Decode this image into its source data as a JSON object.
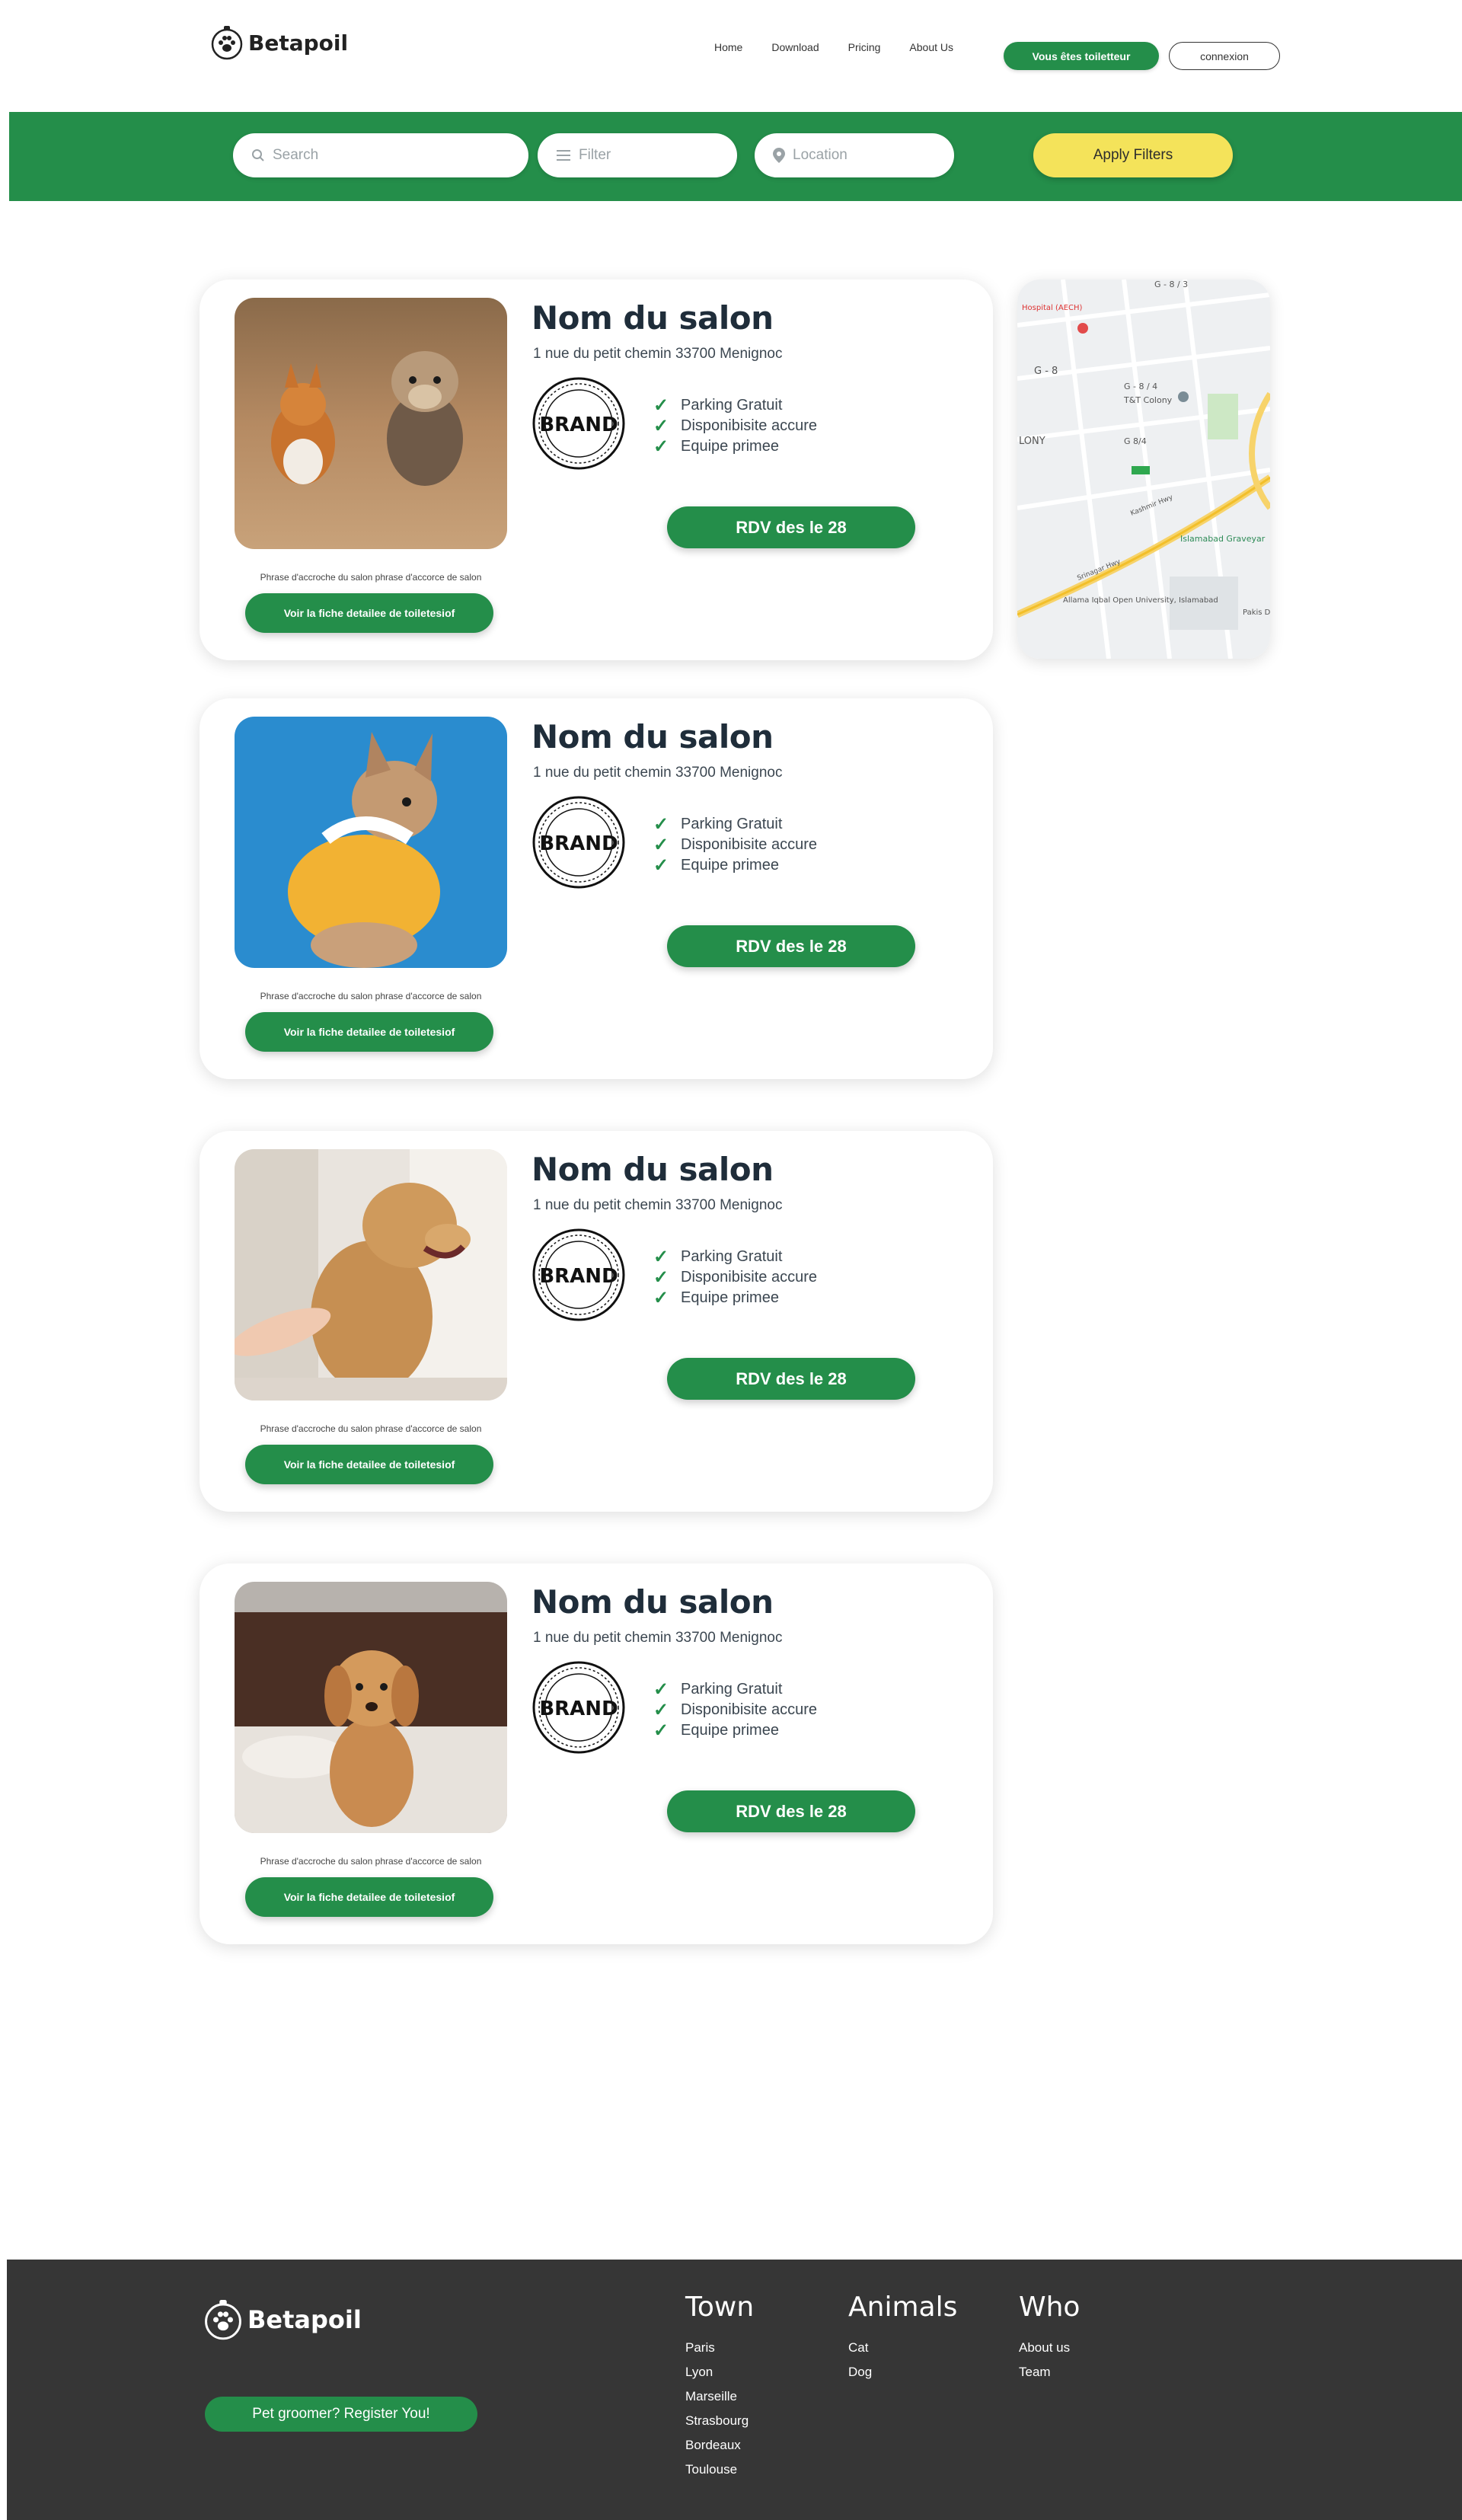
{
  "brand": {
    "name": "Betapoil"
  },
  "nav": {
    "items": [
      "Home",
      "Download",
      "Pricing",
      "About Us"
    ],
    "groomer_button": "Vous êtes toiletteur",
    "login_button": "connexion"
  },
  "filters": {
    "search_placeholder": "Search",
    "filter_placeholder": "Filter",
    "location_placeholder": "Location",
    "apply_label": "Apply Filters"
  },
  "colors": {
    "primary_green": "#248e4a",
    "accent_yellow": "#f4e35a",
    "footer_bg": "#363636"
  },
  "salons": [
    {
      "name": "Nom du salon",
      "address": "1 nue du petit chemin 33700 Menignoc",
      "logo_text": "BRAND",
      "features": [
        "Parking Gratuit",
        "Disponibisite accure",
        "Equipe primee"
      ],
      "rdv_label": "RDV des le 28",
      "tagline": "Phrase d'accroche du salon phrase d'accorce de salon",
      "detail_label": "Voir la fiche detailee de toiletesiof"
    },
    {
      "name": "Nom du salon",
      "address": "1 nue du petit chemin 33700 Menignoc",
      "logo_text": "BRAND",
      "features": [
        "Parking Gratuit",
        "Disponibisite accure",
        "Equipe primee"
      ],
      "rdv_label": "RDV des le 28",
      "tagline": "Phrase d'accroche du salon phrase d'accorce de salon",
      "detail_label": "Voir la fiche detailee de toiletesiof"
    },
    {
      "name": "Nom du salon",
      "address": "1 nue du petit chemin 33700 Menignoc",
      "logo_text": "BRAND",
      "features": [
        "Parking Gratuit",
        "Disponibisite accure",
        "Equipe primee"
      ],
      "rdv_label": "RDV des le 28",
      "tagline": "Phrase d'accroche du salon phrase d'accorce de salon",
      "detail_label": "Voir la fiche detailee de toiletesiof"
    },
    {
      "name": "Nom du salon",
      "address": "1 nue du petit chemin 33700 Menignoc",
      "logo_text": "BRAND",
      "features": [
        "Parking Gratuit",
        "Disponibisite accure",
        "Equipe primee"
      ],
      "rdv_label": "RDV des le 28",
      "tagline": "Phrase d'accroche du salon phrase d'accorce de salon",
      "detail_label": "Voir la fiche detailee de toiletesiof"
    }
  ],
  "map": {
    "labels": [
      "G - 8 / 3",
      "Hospital (AECH)",
      "G - 8",
      "G - 8 / 4",
      "T&T Colony",
      "G 8/4",
      "LONY",
      "Islamabad Graveyar",
      "Allama Iqbal Open University, Islamabad",
      "Pakis Depar",
      "Srinagar Hwy",
      "Kashmir Hwy"
    ]
  },
  "footer": {
    "register_label": "Pet groomer? Register You!",
    "columns": [
      {
        "title": "Town",
        "items": [
          "Paris",
          "Lyon",
          "Marseille",
          "Strasbourg",
          "Bordeaux",
          "Toulouse"
        ]
      },
      {
        "title": "Animals",
        "items": [
          "Cat",
          "Dog"
        ]
      },
      {
        "title": "Who",
        "items": [
          "About us",
          "Team"
        ]
      }
    ]
  }
}
